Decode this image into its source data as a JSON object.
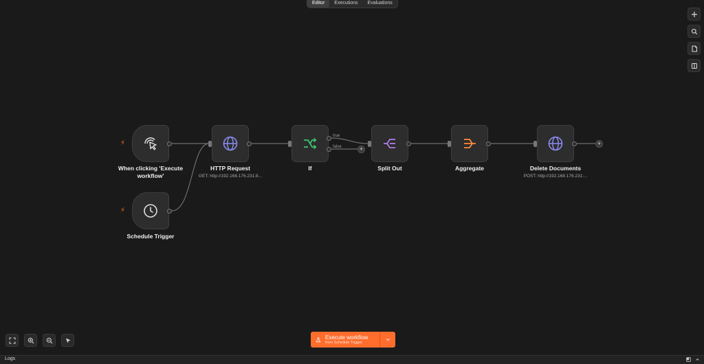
{
  "tabs": [
    {
      "label": "Editor",
      "active": true
    },
    {
      "label": "Executions",
      "active": false
    },
    {
      "label": "Evaluations",
      "active": false
    }
  ],
  "sidebar": {
    "icons": [
      "plus-icon",
      "search-icon",
      "sticky-note-icon",
      "panel-icon"
    ]
  },
  "nodes": {
    "manual_trigger": {
      "label": "When clicking 'Execute workflow'",
      "icon": "cursor-click-icon",
      "color": "#e0e0e0"
    },
    "schedule_trigger": {
      "label": "Schedule Trigger",
      "icon": "clock-icon",
      "color": "#e0e0e0"
    },
    "http_request": {
      "label": "HTTP Request",
      "subtitle": "GET: http://192.168.176.231:8...",
      "icon": "globe-icon",
      "color": "#8b8df6"
    },
    "if": {
      "label": "If",
      "icon": "branch-icon",
      "color": "#3ec46d",
      "branch_true": "true",
      "branch_false": "false"
    },
    "split_out": {
      "label": "Split Out",
      "icon": "split-icon",
      "color": "#b07ee8"
    },
    "aggregate": {
      "label": "Aggregate",
      "icon": "aggregate-icon",
      "color": "#ff8a3d"
    },
    "delete_documents": {
      "label": "Delete Documents",
      "subtitle": "POST: http://192.168.176.231:...",
      "icon": "globe-icon",
      "color": "#8b8df6"
    }
  },
  "canvas_controls": [
    "fit-view-icon",
    "zoom-in-icon",
    "zoom-out-icon",
    "pointer-icon"
  ],
  "execute": {
    "label": "Execute workflow",
    "sublabel": "from Schedule Trigger",
    "color": "#ff6d2d"
  },
  "logs": {
    "label": "Logs"
  }
}
